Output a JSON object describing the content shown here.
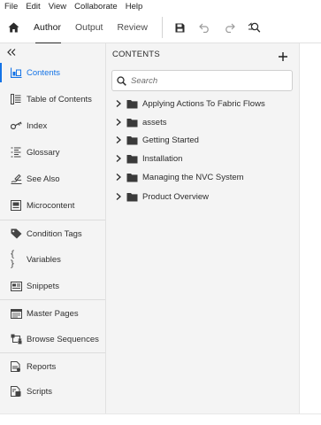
{
  "menu": [
    "File",
    "Edit",
    "View",
    "Collaborate",
    "Help"
  ],
  "toolbar": {
    "tabs": [
      {
        "label": "Author",
        "active": true
      },
      {
        "label": "Output",
        "active": false
      },
      {
        "label": "Review",
        "active": false
      }
    ],
    "icons": [
      "home-icon",
      "save-icon",
      "undo-icon",
      "redo-icon",
      "find-replace-icon"
    ]
  },
  "sidebar": {
    "collapse_icon": "double-chevron-left-icon",
    "accent": "#1473e6",
    "items": [
      {
        "label": "Contents",
        "icon": "contents-icon",
        "active": true
      },
      {
        "label": "Table of Contents",
        "icon": "toc-icon"
      },
      {
        "label": "Index",
        "icon": "key-icon"
      },
      {
        "label": "Glossary",
        "icon": "glossary-list-icon"
      },
      {
        "label": "See Also",
        "icon": "see-also-icon"
      },
      {
        "label": "Microcontent",
        "icon": "microcontent-icon"
      },
      {
        "label": "Condition Tags",
        "icon": "tag-icon"
      },
      {
        "label": "Variables",
        "icon": "braces-icon"
      },
      {
        "label": "Snippets",
        "icon": "snippet-icon"
      },
      {
        "label": "Master Pages",
        "icon": "master-page-icon"
      },
      {
        "label": "Browse Sequences",
        "icon": "browse-sequence-icon"
      },
      {
        "label": "Reports",
        "icon": "reports-icon"
      },
      {
        "label": "Scripts",
        "icon": "scripts-icon"
      }
    ]
  },
  "contents_panel": {
    "title": "CONTENTS",
    "add_icon": "plus-icon",
    "search": {
      "placeholder": "Search",
      "value": ""
    },
    "folders": [
      {
        "label": "Applying Actions To Fabric Flows",
        "expanded": false
      },
      {
        "label": "assets",
        "expanded": false
      },
      {
        "label": "Getting Started",
        "expanded": false
      },
      {
        "label": "Installation",
        "expanded": false
      },
      {
        "label": "Managing the NVC System",
        "expanded": false
      },
      {
        "label": "Product Overview",
        "expanded": false
      }
    ]
  }
}
